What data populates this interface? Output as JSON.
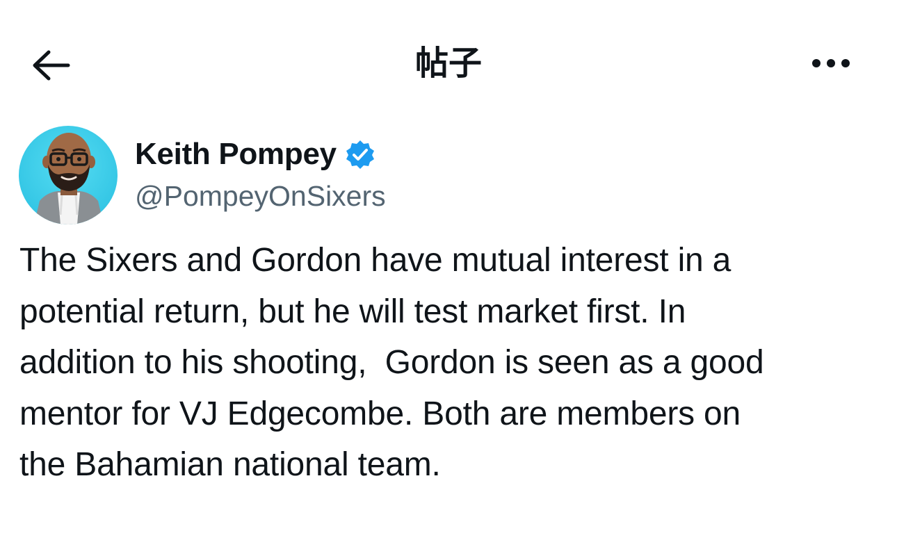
{
  "header": {
    "title": "帖子",
    "back_icon": "arrow-left-icon",
    "more_icon": "more-horizontal-icon"
  },
  "author": {
    "name": "Keith Pompey",
    "handle": "@PompeyOnSixers",
    "verified": true,
    "verified_color": "#1d9bf0",
    "avatar_icon": "memoji-avatar",
    "avatar_bg": "#3fd0ea"
  },
  "post": {
    "text": "The Sixers and Gordon have mutual interest in a\npotential return, but he will test market first. In\naddition to his shooting,  Gordon is seen as a good\nmentor for VJ Edgecombe. Both are members on\nthe Bahamian national team."
  },
  "colors": {
    "text_primary": "#0f1419",
    "text_secondary": "#536471",
    "accent": "#1d9bf0"
  }
}
